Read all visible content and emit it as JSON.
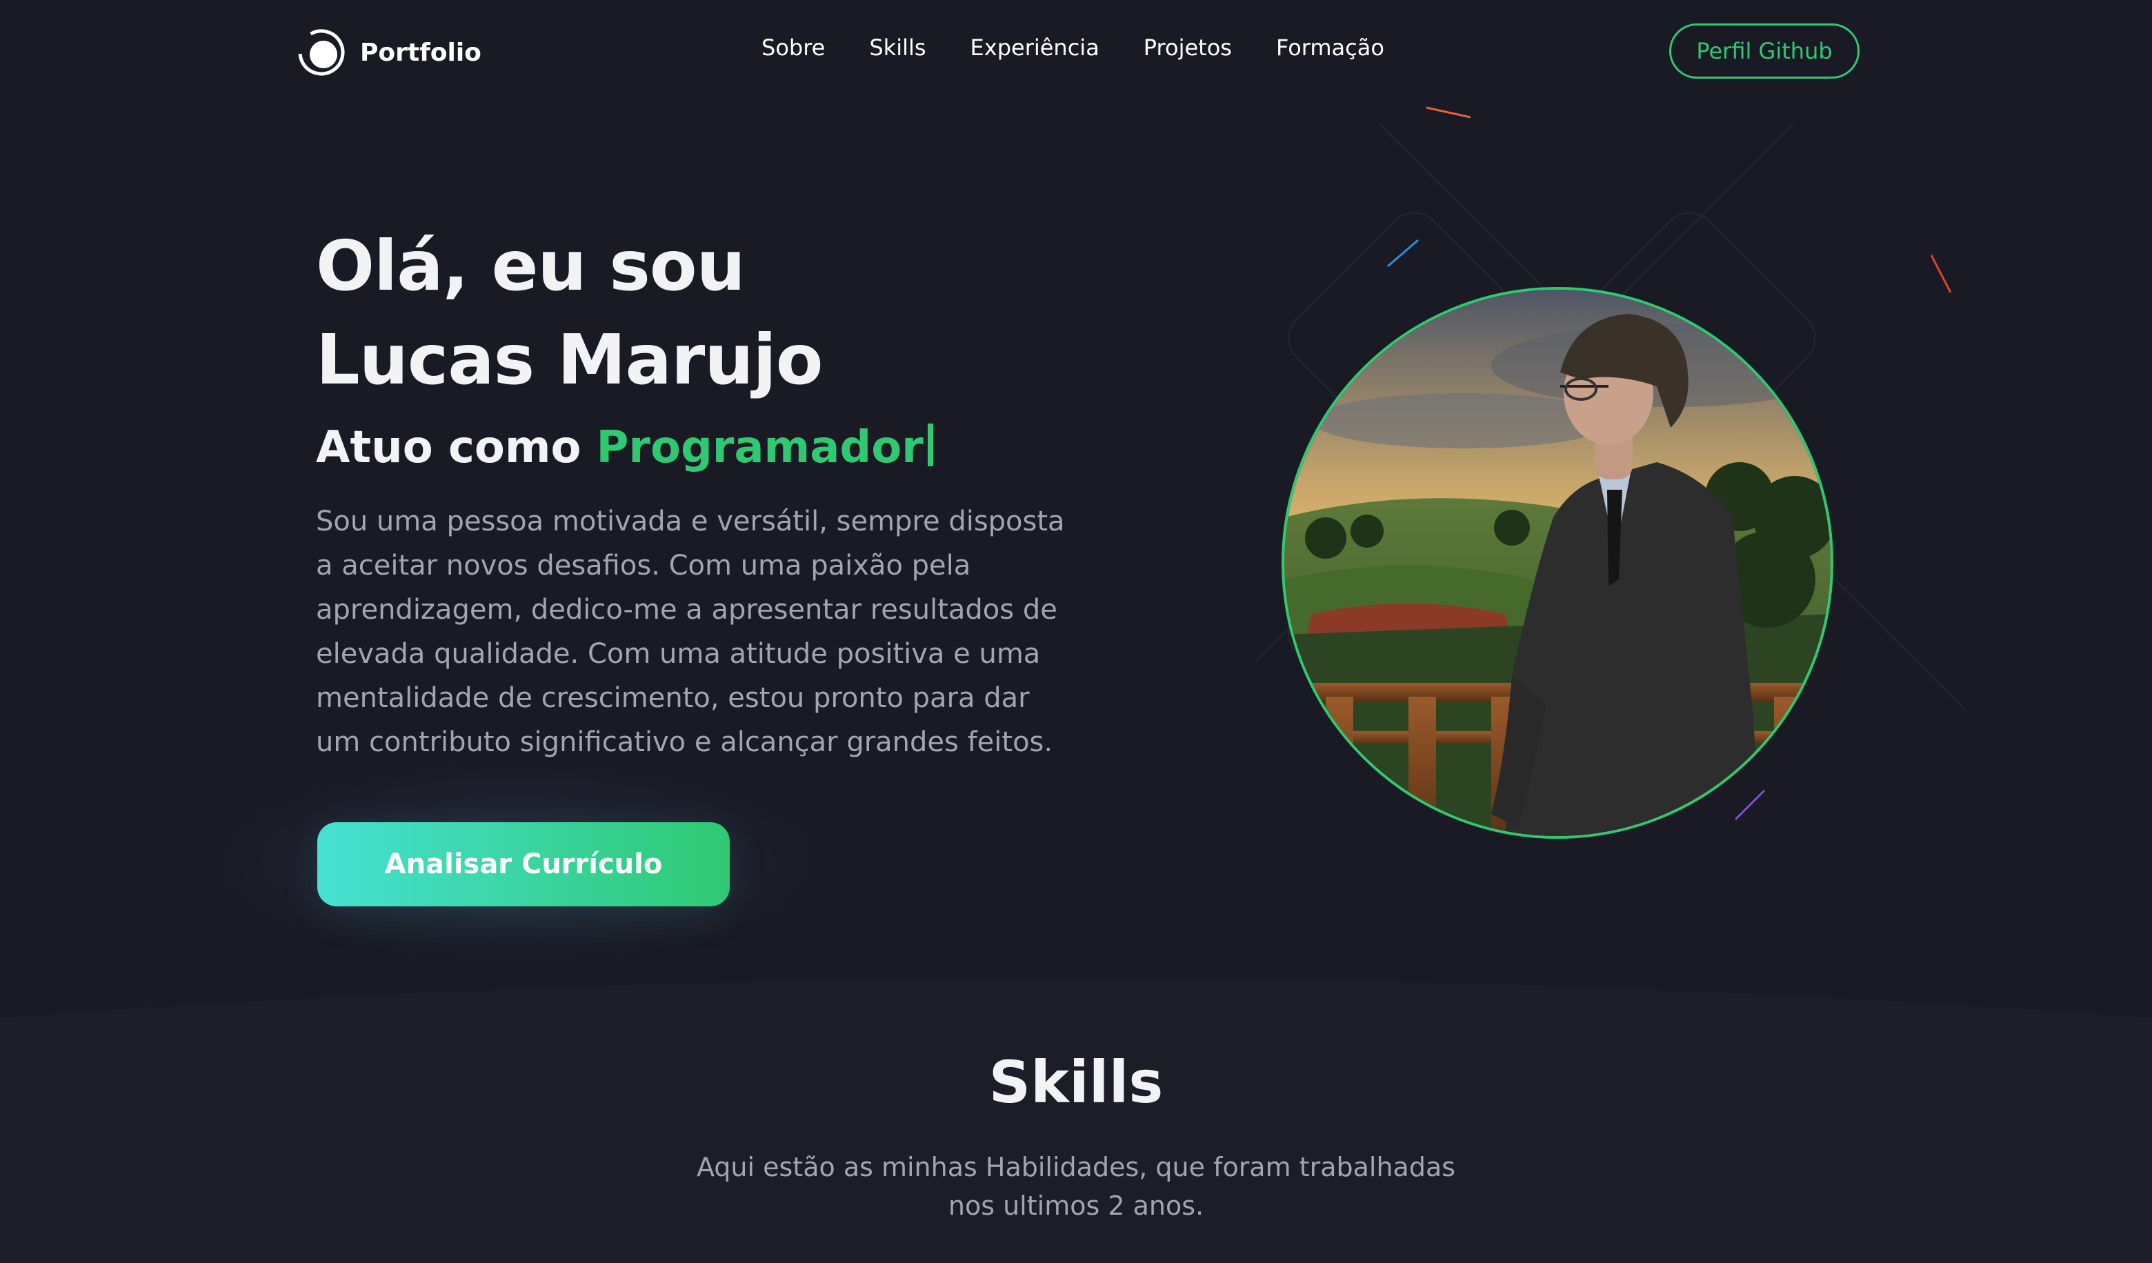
{
  "nav": {
    "logo_text": "Portfolio",
    "links": [
      "Sobre",
      "Skills",
      "Experiência",
      "Projetos",
      "Formação"
    ],
    "github_button": "Perfil Github"
  },
  "hero": {
    "title_line1": "Olá, eu sou",
    "title_line2": "Lucas Marujo",
    "role_prefix": "Atuo como",
    "role_value": "Programador",
    "bio": "Sou uma pessoa motivada e versátil, sempre disposta a aceitar novos desafios. Com uma paixão pela aprendizagem, dedico-me a apresentar resultados de elevada qualidade. Com uma atitude positiva e uma mentalidade de crescimento, estou pronto para dar um contributo significativo e alcançar grandes feitos.",
    "cta_button": "Analisar Currículo"
  },
  "skills": {
    "title": "Skills",
    "subtitle": "Aqui estão as minhas Habilidades, que foram trabalhadas nos ultimos 2 anos."
  },
  "colors": {
    "background": "#191a23",
    "accent": "#2fc972",
    "gradient_start": "#46e1d3",
    "muted_text": "#a4a4b0"
  },
  "icons": {
    "logo": "ring-logo-icon",
    "avatar": "profile-photo"
  }
}
